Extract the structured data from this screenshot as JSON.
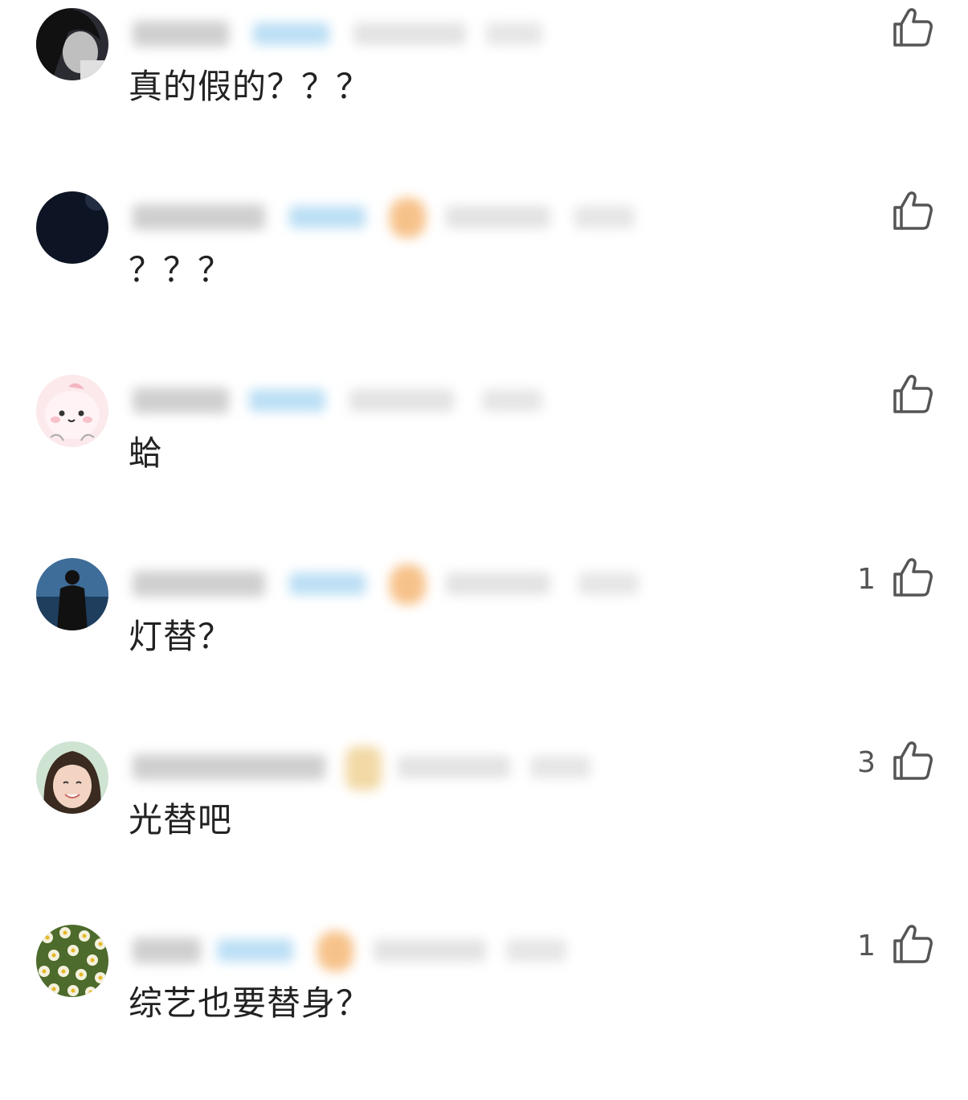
{
  "comments": [
    {
      "text": "真的假的？？？",
      "like_count": "",
      "avatar": "woman-portrait",
      "has_badge": false
    },
    {
      "text": "？？？",
      "like_count": "",
      "avatar": "dark-circle",
      "has_badge": true
    },
    {
      "text": "蛤",
      "like_count": "",
      "avatar": "pink-cartoon",
      "has_badge": false
    },
    {
      "text": "灯替？",
      "like_count": "1",
      "avatar": "man-on-beach",
      "has_badge": true
    },
    {
      "text": "光替吧",
      "like_count": "3",
      "avatar": "smiling-girl",
      "has_badge": true
    },
    {
      "text": "综艺也要替身？",
      "like_count": "1",
      "avatar": "flowers",
      "has_badge": true
    }
  ],
  "colors": {
    "text": "#222222",
    "like_icon": "#555555",
    "tag": "#bcdff5",
    "badge": "#f7c28a",
    "meta": "#e6e6e6"
  }
}
